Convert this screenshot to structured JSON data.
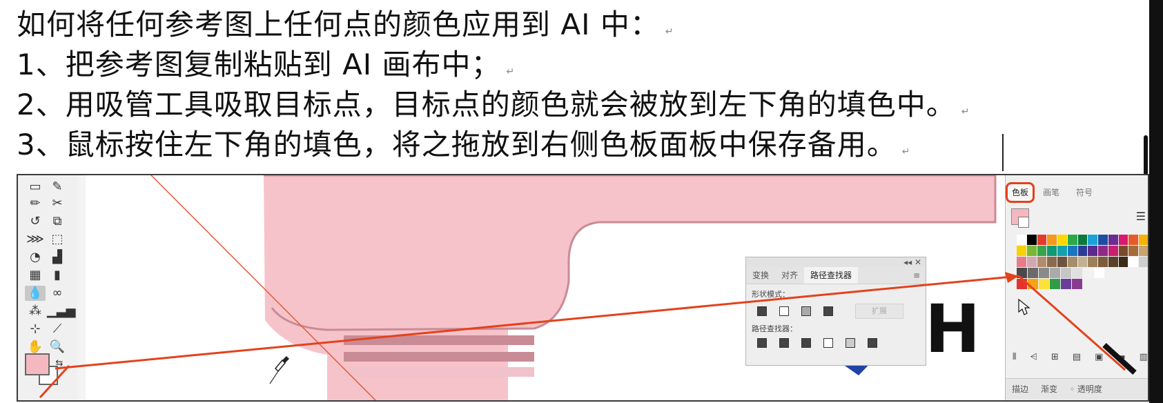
{
  "instructions": {
    "lines": [
      "如何将任何参考图上任何点的颜色应用到 AI 中：",
      "1、把参考图复制粘贴到 AI 画布中；",
      "2、用吸管工具吸取目标点，目标点的颜色就会被放到左下角的填色中。",
      "3、鼠标按住左下角的填色，将之拖放到右侧色板面板中保存备用。"
    ],
    "paragraph_mark": "↵"
  },
  "float_panel": {
    "tabs": [
      "变换",
      "对齐",
      "路径查找器"
    ],
    "active_tab": "路径查找器",
    "shape_modes_label": "形状模式：",
    "expand_button": "扩展",
    "pathfinders_label": "路径查找器："
  },
  "swatch_panel": {
    "tabs": [
      "色板",
      "画笔",
      "符号"
    ],
    "active_tab": "色板",
    "bottom_tabs": [
      "描边",
      "渐变",
      "◦ 透明度"
    ],
    "current_fill_color": "#f5b8c0",
    "swatch_rows": [
      [
        "#ffffff",
        "#000000",
        "#e43b2b",
        "#f39a1c",
        "#ffd800",
        "#2ba84a",
        "#0a7a3d",
        "#1aa3d6",
        "#1d4fa0",
        "#6a2d91",
        "#d71a6e",
        "#e95a2a",
        "#f7b20a"
      ],
      [
        "#f6d300",
        "#7ab733",
        "#37a54c",
        "#0f9a73",
        "#13a1b0",
        "#1a76c0",
        "#2b3b96",
        "#5d2b8c",
        "#8d2a87",
        "#c81f6f",
        "#7a4b2a",
        "#a46c3a",
        "#c8a46e"
      ],
      [
        "#e77c8c",
        "#d4a8b0",
        "#b38b6d",
        "#8c6a4f",
        "#6e5340",
        "#a58d6a",
        "#c2b092",
        "#9d7f5a",
        "#7b5d3a",
        "#5b4128",
        "#3d2b1a",
        "#ffffff",
        "#cfcfcf"
      ],
      [
        "#4a4a4a",
        "#6a6a6a",
        "#8a8a8a",
        "#aaaaaa",
        "#c6c6c6",
        "#e0e0e0",
        "#f2f2f2",
        "#ffffff"
      ],
      [
        "#e5322d",
        "#f7a21b",
        "#fde13a",
        "#2f9c48",
        "#6a3d98",
        "#8a3b8f"
      ]
    ]
  },
  "colors": {
    "accent_red": "#e4411b",
    "pink_fill": "#f5b8c0",
    "pink_reference": "#f7c3cb"
  },
  "icons": [
    "pencil-icon",
    "scissors-icon",
    "rotate-icon",
    "free-transform-icon",
    "width-icon",
    "eyedropper-icon",
    "blend-icon",
    "column-graph-icon",
    "artboard-icon",
    "slice-icon",
    "hand-icon",
    "zoom-icon",
    "swap-fill-stroke-icon",
    "panel-menu-icon"
  ]
}
